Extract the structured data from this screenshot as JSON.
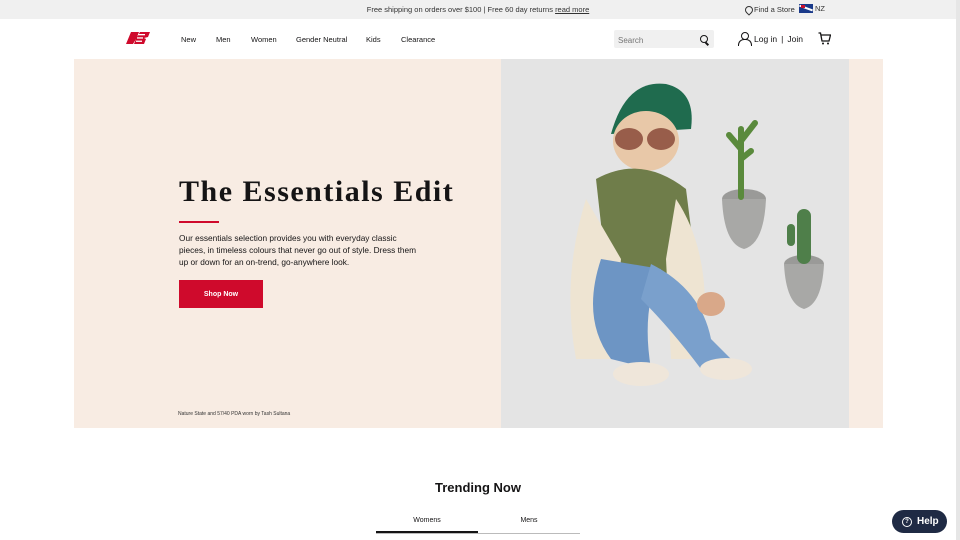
{
  "topbar": {
    "promo_prefix": "Free shipping on orders over $100 | Free 60 day returns",
    "promo_link": "read more",
    "store_label": "Find a Store",
    "region_label": "NZ"
  },
  "header": {
    "nav": [
      "New",
      "Men",
      "Women",
      "Gender Neutral",
      "Kids",
      "Clearance"
    ],
    "search_placeholder": "Search",
    "login_label": "Log in",
    "separator": "|",
    "join_label": "Join"
  },
  "hero": {
    "title": "The Essentials Edit",
    "body": "Our essentials selection provides you with everyday classic pieces, in timeless colours that never go out of style. Dress them up or down for an on-trend, go-anywhere look.",
    "button_label": "Shop Now",
    "caption": "Nature State and 57/40 PDA worn by Tash Sultana"
  },
  "trending": {
    "title": "Trending Now",
    "tabs": [
      "Womens",
      "Mens"
    ],
    "active_tab": "Womens"
  },
  "help": {
    "label": "Help"
  },
  "colors": {
    "brand_red": "#cf0a2c",
    "hero_bg": "#f8ece3",
    "help_bg": "#1f2a44"
  },
  "icons": [
    "pin-icon",
    "nz-flag-icon",
    "new-balance-logo",
    "search-icon",
    "account-icon",
    "cart-icon",
    "help-icon"
  ]
}
